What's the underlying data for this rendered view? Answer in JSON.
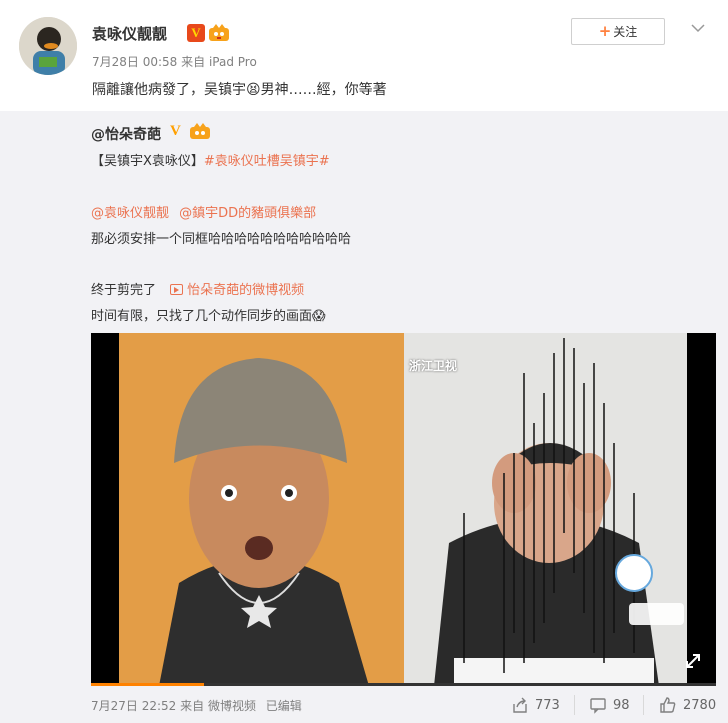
{
  "post": {
    "username": "袁咏仪靓靓",
    "verified": "V",
    "timestamp": "7月28日 00:58",
    "source": "来自 iPad Pro",
    "text": "隔離讓他病發了，吴镇宇😫男神……經，你等著",
    "follow_label": "关注"
  },
  "repost": {
    "author": "@怡朵奇葩",
    "verified": "V",
    "line1_prefix": "【吴镇宇X袁咏仪】",
    "line1_tag": "#袁咏仪吐槽吴镇宇#",
    "mention1": "@袁咏仪靓靓",
    "mention2": "@鎮宇DD的豬頭俱樂部",
    "line3": "那必须安排一个同框哈哈哈哈哈哈哈哈哈哈哈",
    "line4_prefix": "终于剪完了",
    "video_link": "怡朵奇葩的微博视频",
    "line5": "时间有限，只找了几个动作同步的画面😱",
    "video": {
      "channel_label": "浙江卫视",
      "progress": 0.18
    },
    "footer": {
      "timestamp": "7月27日 22:52",
      "source": "来自 微博视频",
      "edited": "已编辑"
    },
    "actions": {
      "share_count": "773",
      "comment_count": "98",
      "like_count": "2780"
    }
  },
  "colors": {
    "link": "#eb7350",
    "follow_plus": "#ff8140",
    "progress_fill": "#ff8200",
    "verified_orange": "#ffa000"
  }
}
